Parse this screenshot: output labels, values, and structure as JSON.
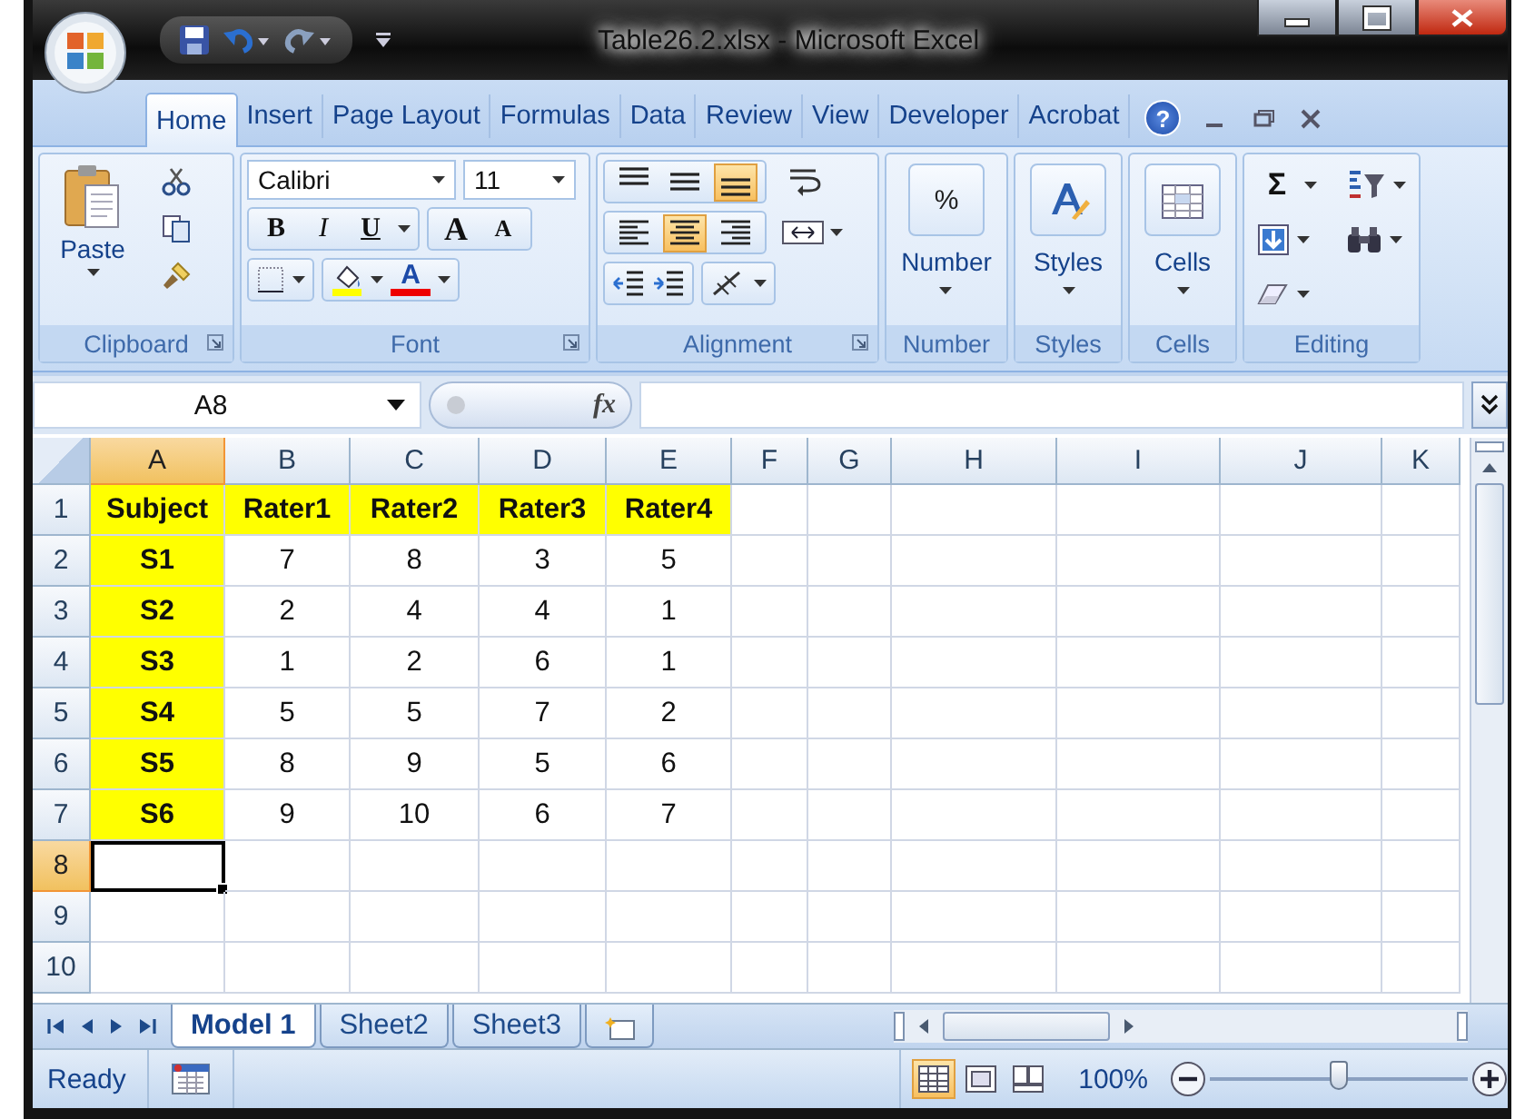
{
  "window": {
    "title": "Table26.2.xlsx - Microsoft Excel"
  },
  "ribbon_tabs": [
    {
      "label": "Home",
      "selected": true
    },
    {
      "label": "Insert",
      "selected": false
    },
    {
      "label": "Page Layout",
      "selected": false
    },
    {
      "label": "Formulas",
      "selected": false
    },
    {
      "label": "Data",
      "selected": false
    },
    {
      "label": "Review",
      "selected": false
    },
    {
      "label": "View",
      "selected": false
    },
    {
      "label": "Developer",
      "selected": false
    },
    {
      "label": "Acrobat",
      "selected": false
    }
  ],
  "help": "?",
  "clipboard": {
    "paste": "Paste",
    "label": "Clipboard"
  },
  "font": {
    "name": "Calibri",
    "size": "11",
    "bold": "B",
    "italic": "I",
    "underline": "U",
    "grow": "A",
    "shrink": "A",
    "font_color_button": "A",
    "label": "Font"
  },
  "alignment": {
    "vertical": [
      {
        "kind": "top",
        "selected": false
      },
      {
        "kind": "middle",
        "selected": false
      },
      {
        "kind": "bottom",
        "selected": true
      }
    ],
    "horizontal": [
      {
        "kind": "left",
        "selected": false
      },
      {
        "kind": "center",
        "selected": true
      },
      {
        "kind": "right",
        "selected": false
      }
    ],
    "label": "Alignment"
  },
  "number": {
    "symbol": "%",
    "button": "Number",
    "label": "Number"
  },
  "styles": {
    "button": "Styles",
    "label": "Styles"
  },
  "cells": {
    "button": "Cells",
    "label": "Cells"
  },
  "editing": {
    "sum": "Σ",
    "label": "Editing"
  },
  "formula_bar": {
    "name_box": "A8",
    "fx": "fx"
  },
  "sheet": {
    "columns": [
      {
        "label": "A",
        "selected": true
      },
      {
        "label": "B",
        "selected": false
      },
      {
        "label": "C",
        "selected": false
      },
      {
        "label": "D",
        "selected": false
      },
      {
        "label": "E",
        "selected": false
      },
      {
        "label": "F",
        "selected": false
      },
      {
        "label": "G",
        "selected": false
      },
      {
        "label": "H",
        "selected": false
      },
      {
        "label": "I",
        "selected": false
      },
      {
        "label": "J",
        "selected": false
      },
      {
        "label": "K",
        "selected": false
      }
    ],
    "rows": [
      {
        "label": "1",
        "selected": false,
        "cells": [
          {
            "text": "Subject",
            "highlighted": true
          },
          {
            "text": "Rater1",
            "highlighted": true
          },
          {
            "text": "Rater2",
            "highlighted": true
          },
          {
            "text": "Rater3",
            "highlighted": true
          },
          {
            "text": "Rater4",
            "highlighted": true
          }
        ]
      },
      {
        "label": "2",
        "selected": false,
        "cells": [
          {
            "text": "S1",
            "highlighted": true
          },
          {
            "text": "7",
            "highlighted": false
          },
          {
            "text": "8",
            "highlighted": false
          },
          {
            "text": "3",
            "highlighted": false
          },
          {
            "text": "5",
            "highlighted": false
          }
        ]
      },
      {
        "label": "3",
        "selected": false,
        "cells": [
          {
            "text": "S2",
            "highlighted": true
          },
          {
            "text": "2",
            "highlighted": false
          },
          {
            "text": "4",
            "highlighted": false
          },
          {
            "text": "4",
            "highlighted": false
          },
          {
            "text": "1",
            "highlighted": false
          }
        ]
      },
      {
        "label": "4",
        "selected": false,
        "cells": [
          {
            "text": "S3",
            "highlighted": true
          },
          {
            "text": "1",
            "highlighted": false
          },
          {
            "text": "2",
            "highlighted": false
          },
          {
            "text": "6",
            "highlighted": false
          },
          {
            "text": "1",
            "highlighted": false
          }
        ]
      },
      {
        "label": "5",
        "selected": false,
        "cells": [
          {
            "text": "S4",
            "highlighted": true
          },
          {
            "text": "5",
            "highlighted": false
          },
          {
            "text": "5",
            "highlighted": false
          },
          {
            "text": "7",
            "highlighted": false
          },
          {
            "text": "2",
            "highlighted": false
          }
        ]
      },
      {
        "label": "6",
        "selected": false,
        "cells": [
          {
            "text": "S5",
            "highlighted": true
          },
          {
            "text": "8",
            "highlighted": false
          },
          {
            "text": "9",
            "highlighted": false
          },
          {
            "text": "5",
            "highlighted": false
          },
          {
            "text": "6",
            "highlighted": false
          }
        ]
      },
      {
        "label": "7",
        "selected": false,
        "cells": [
          {
            "text": "S6",
            "highlighted": true
          },
          {
            "text": "9",
            "highlighted": false
          },
          {
            "text": "10",
            "highlighted": false
          },
          {
            "text": "6",
            "highlighted": false
          },
          {
            "text": "7",
            "highlighted": false
          }
        ]
      },
      {
        "label": "8",
        "selected": true
      },
      {
        "label": "9",
        "selected": false
      },
      {
        "label": "10",
        "selected": false
      }
    ]
  },
  "sheet_tabs": [
    {
      "label": "Model 1",
      "selected": true
    },
    {
      "label": "Sheet2",
      "selected": false
    },
    {
      "label": "Sheet3",
      "selected": false
    }
  ],
  "status_bar": {
    "status": "Ready",
    "views": [
      {
        "kind": "normal",
        "selected": true
      },
      {
        "kind": "page_layout",
        "selected": false
      },
      {
        "kind": "page_break",
        "selected": false
      }
    ],
    "zoom": "100%",
    "zoom_slider": {
      "level": 0.5
    }
  }
}
